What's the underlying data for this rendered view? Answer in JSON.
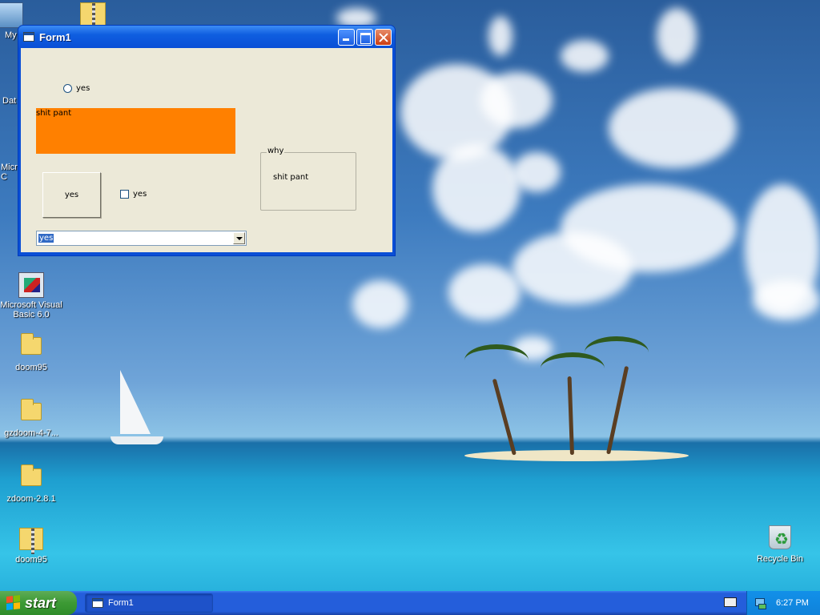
{
  "desktop": {
    "icons": [
      {
        "label": "My",
        "icon": "my-computer-icon"
      },
      {
        "label": "Dat",
        "icon": "zip-folder-icon"
      },
      {
        "label": "Micro C",
        "icon": "folder-icon"
      },
      {
        "label": "Microsoft Visual Basic 6.0",
        "icon": "visual-basic-icon"
      },
      {
        "label": "doom95",
        "icon": "folder-icon"
      },
      {
        "label": "gzdoom-4-7...",
        "icon": "folder-icon"
      },
      {
        "label": "zdoom-2.8.1",
        "icon": "folder-icon"
      },
      {
        "label": "doom95",
        "icon": "zip-folder-icon"
      },
      {
        "label": "Recycle Bin",
        "icon": "recycle-bin-icon"
      }
    ]
  },
  "window": {
    "title": "Form1",
    "radio_label": "yes",
    "orange_label_text": "shit pant",
    "button_label": "yes",
    "checkbox_label": "yes",
    "frame_title": "why",
    "frame_text": "shit pant",
    "combo_value": "yes",
    "colors": {
      "label_background": "#ff8000",
      "form_background": "#ece9d8",
      "titlebar": "#0a4fd6"
    }
  },
  "taskbar": {
    "start_label": "start",
    "task_button_label": "Form1",
    "clock": "6:27 PM"
  }
}
